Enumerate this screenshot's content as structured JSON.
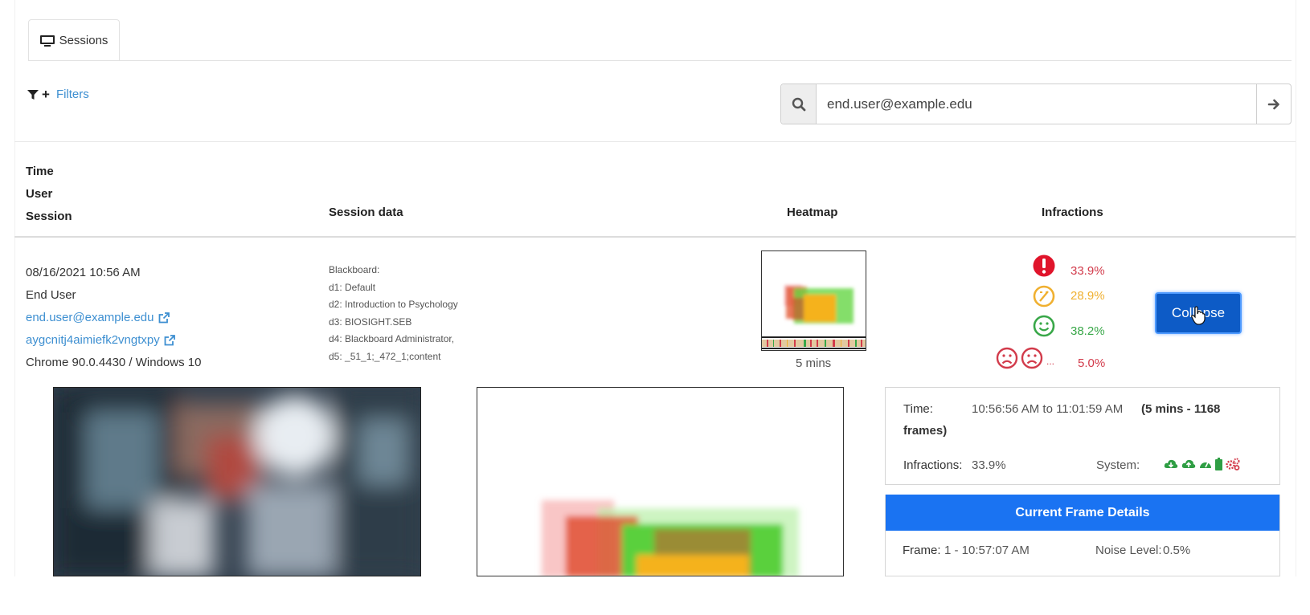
{
  "tabs": [
    {
      "label": "Sessions",
      "icon": "monitor-icon"
    }
  ],
  "filters": {
    "label": "Filters"
  },
  "search": {
    "value": "end.user@example.edu",
    "placeholder": ""
  },
  "table": {
    "headers": {
      "time": "Time",
      "user": "User",
      "session": "Session",
      "session_data": "Session data",
      "heatmap": "Heatmap",
      "infractions": "Infractions"
    }
  },
  "row": {
    "datetime": "08/16/2021 10:56 AM",
    "user_name": "End User",
    "email": "end.user@example.edu",
    "session_id": "aygcnitj4aimiefk2vngtxpy",
    "client": "Chrome 90.0.4430 / Windows 10",
    "session_data": [
      "Blackboard:",
      "d1: Default",
      "d2: Introduction to Psychology",
      "d3: BIOSIGHT.SEB",
      "d4: Blackboard Administrator,",
      "d5: _51_1;_472_1;content"
    ],
    "heatmap_caption": "5 mins",
    "infractions": {
      "alert": "33.9%",
      "warning": "28.9%",
      "ok": "38.2%",
      "multiple_ellipsis": "...",
      "multiple": "5.0%"
    },
    "collapse_label": "Collapse"
  },
  "details": {
    "time_label": "Time:",
    "time_value": "10:56:56 AM to 11:01:59 AM",
    "time_summary": "(5 mins - 1168 frames)",
    "infractions_label": "Infractions:",
    "infractions_value": "33.9%",
    "system_label": "System:"
  },
  "current_frame": {
    "title": "Current Frame Details",
    "frame_label": "Frame:",
    "frame_value": "1 - 10:57:07 AM",
    "noise_label": "Noise Level:",
    "noise_value": "0.5%"
  },
  "colors": {
    "link": "#3d8fd1",
    "bad": "#d23b4b",
    "warn": "#f0b030",
    "good": "#38a748",
    "primary": "#0d5bc6",
    "header_blue": "#1a73f2"
  }
}
